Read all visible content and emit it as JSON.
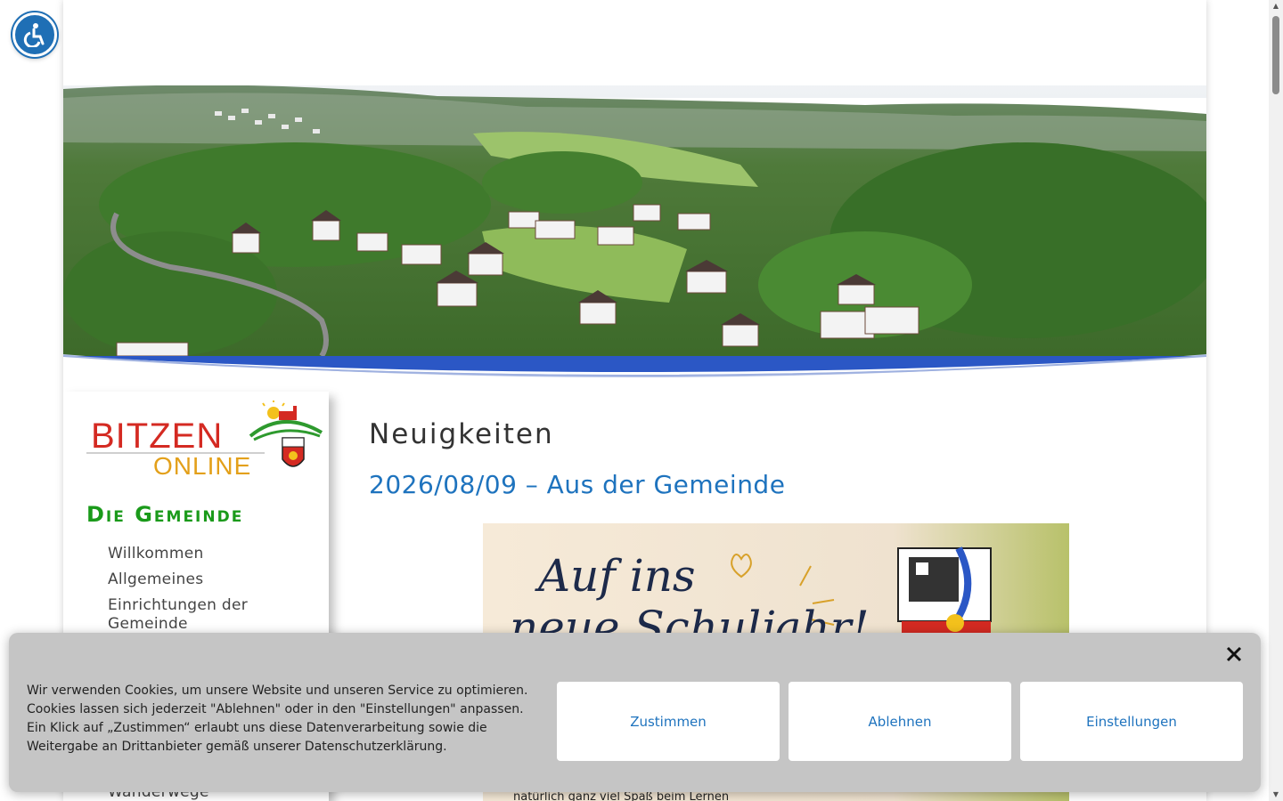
{
  "accessibility": {
    "icon": "wheelchair-icon"
  },
  "sidebar": {
    "logo": {
      "line1": "BITZEN",
      "line2": "ONLINE"
    },
    "heading": "Die Gemeinde",
    "items": [
      {
        "label": "Willkommen"
      },
      {
        "label": "Allgemeines"
      },
      {
        "label": "Einrichtungen der Gemeinde"
      }
    ],
    "partial_item": "Wanderwege"
  },
  "main": {
    "title": "Neuigkeiten",
    "post_title": "2026/08/09 – Aus der Gemeinde",
    "post_image": {
      "line1": "Auf ins",
      "line2": "neue Schuljahr!",
      "caption": "natürlich ganz viel Spaß beim Lernen"
    }
  },
  "cookie_banner": {
    "text": "Wir verwenden Cookies, um unsere Website und unseren Service zu optimieren. Cookies lassen sich jederzeit \"Ablehnen\" oder in den \"Einstellungen\" anpassen. Ein Klick auf „Zustimmen“ erlaubt uns diese Datenverarbeitung sowie die Weitergabe an Drittanbieter gemäß unserer Datenschutzerklärung.",
    "accept": "Zustimmen",
    "decline": "Ablehnen",
    "settings": "Einstellungen",
    "close_icon": "close-icon"
  },
  "colors": {
    "accent_blue": "#1e73be",
    "heading_green": "#1a9a1a",
    "banner_bg": "#c5c5c5",
    "wave_blue": "#2b57c5"
  }
}
